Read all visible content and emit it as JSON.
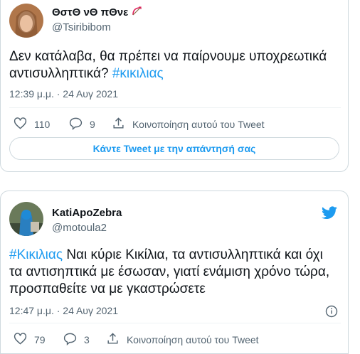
{
  "tweet1": {
    "display_name": "ΘστΘ νΘ πΘνε",
    "handle": "@Tsiribibom",
    "text_plain": "Δεν κατάλαβα, θα πρέπει να παίρνουμε υποχρεωτικά αντισυλληπτικά? ",
    "hashtag": "#κικιλιας",
    "timestamp": "12:39 μ.μ. · 24 Αυγ 2021",
    "likes": "110",
    "replies": "9",
    "share_label": "Κοινοποίηση αυτού του Tweet",
    "reply_button_label": "Κάντε Tweet με την απάντησή σας"
  },
  "tweet2": {
    "display_name": "KatiApoZebra",
    "handle": "@motoula2",
    "hashtag": "#Κικιλιας",
    "text_plain": " Ναι κύριε Κικίλια, τα αντισυλληπτικά και όχι τα αντισηπτικά με έσωσαν, γιατί ενάμιση χρόνο τώρα, προσπαθείτε να με γκαστρώσετε",
    "timestamp": "12:47 μ.μ. · 24 Αυγ 2021",
    "likes": "79",
    "replies": "3",
    "share_label": "Κοινοποίηση αυτού του Tweet"
  },
  "icons": {
    "bow": "bow-and-arrow-icon",
    "like": "heart-icon",
    "reply": "speech-bubble-icon",
    "share": "share-icon",
    "logo": "twitter-bird-icon",
    "info": "info-icon"
  },
  "colors": {
    "accent": "#1d9bf0",
    "muted": "#536471",
    "border": "#cfd9de"
  }
}
